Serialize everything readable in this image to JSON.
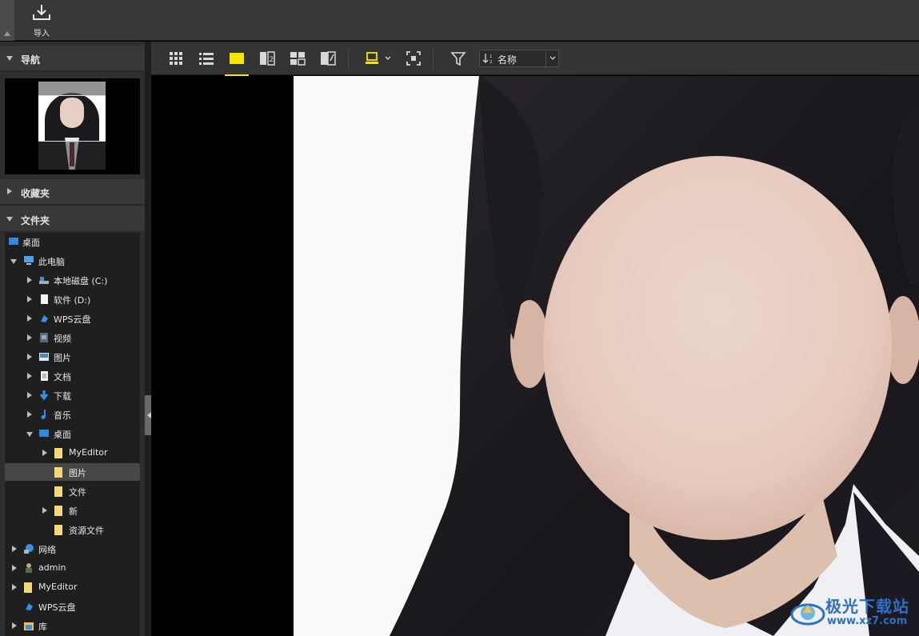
{
  "toolbar": {
    "import_label": "导入"
  },
  "navigation": {
    "title": "导航"
  },
  "favorites": {
    "title": "收藏夹"
  },
  "folders": {
    "title": "文件夹",
    "items": [
      {
        "label": "桌面",
        "icon": "desktop-icon"
      },
      {
        "label": "此电脑",
        "icon": "computer-icon"
      },
      {
        "label": "本地磁盘 (C:)",
        "icon": "drive-icon"
      },
      {
        "label": "软件 (D:)",
        "icon": "drive-icon"
      },
      {
        "label": "WPS云盘",
        "icon": "cloud-icon"
      },
      {
        "label": "视频",
        "icon": "video-icon"
      },
      {
        "label": "图片",
        "icon": "pictures-icon"
      },
      {
        "label": "文档",
        "icon": "document-icon"
      },
      {
        "label": "下载",
        "icon": "download-icon"
      },
      {
        "label": "音乐",
        "icon": "music-icon"
      },
      {
        "label": "桌面",
        "icon": "desktop-icon"
      },
      {
        "label": "MyEditor",
        "icon": "folder-icon"
      },
      {
        "label": "图片",
        "icon": "folder-icon"
      },
      {
        "label": "文件",
        "icon": "folder-icon"
      },
      {
        "label": "新",
        "icon": "folder-icon"
      },
      {
        "label": "资源文件",
        "icon": "folder-icon"
      },
      {
        "label": "网络",
        "icon": "network-icon"
      },
      {
        "label": "admin",
        "icon": "user-icon"
      },
      {
        "label": "MyEditor",
        "icon": "folder-icon"
      },
      {
        "label": "WPS云盘",
        "icon": "cloud-icon"
      },
      {
        "label": "库",
        "icon": "library-icon"
      }
    ]
  },
  "viewbar": {
    "sort_label": "名称",
    "active_color": "#f5e500"
  },
  "watermark": {
    "line1": "极光下载站",
    "line2": "www.xz7.com"
  }
}
